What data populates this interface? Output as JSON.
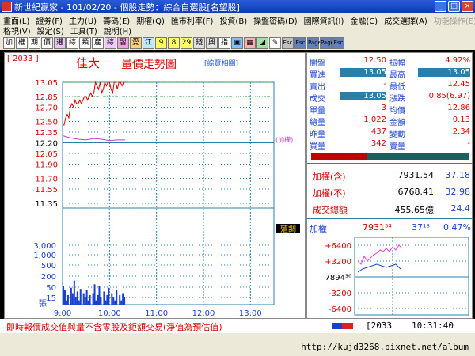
{
  "window": {
    "title": "新世紀贏家 - 101/02/20 - 個股走勢：綜合自選股[名望股]",
    "buttons": [
      "_",
      "□",
      "×"
    ]
  },
  "menu": {
    "row1": [
      {
        "label": "畫面(L)",
        "disabled": false
      },
      {
        "label": "證券(F)",
        "disabled": false
      },
      {
        "label": "主力(U)",
        "disabled": false
      },
      {
        "label": "籌碼(E)",
        "disabled": false
      },
      {
        "label": "期權(Q)",
        "disabled": false
      },
      {
        "label": "匯市利率(F)",
        "disabled": false
      },
      {
        "label": "投資(B)",
        "disabled": false
      },
      {
        "label": "操盤密碼(D)",
        "disabled": false
      },
      {
        "label": "國際資訊(I)",
        "disabled": false
      },
      {
        "label": "金融(C)",
        "disabled": false
      },
      {
        "label": "成交選擇(A)",
        "disabled": false
      },
      {
        "label": "功能操作(E)",
        "disabled": true
      }
    ],
    "row2": [
      {
        "label": "格視(V)",
        "disabled": false
      },
      {
        "label": "設定(S)",
        "disabled": false
      },
      {
        "label": "工具(T)",
        "disabled": false
      },
      {
        "label": "說明(H)",
        "disabled": false
      }
    ]
  },
  "toolbar": [
    {
      "label": "加",
      "bg": "#ffffff"
    },
    {
      "label": "權",
      "bg": "#ffffff"
    },
    {
      "label": "期",
      "bg": "#ffffff"
    },
    {
      "label": "價",
      "bg": "#ffffff"
    },
    {
      "label": "選",
      "bg": "#e6c8f0"
    },
    {
      "label": "綜",
      "bg": "#ffffff"
    },
    {
      "label": "類",
      "bg": "#ffffff"
    },
    {
      "label": "產",
      "bg": "#ffffff"
    },
    {
      "label": "綜",
      "bg": "#f0c8ff"
    },
    {
      "label": "習",
      "bg": "#f0a0e0"
    },
    {
      "label": "愛",
      "bg": "#ffd080"
    },
    {
      "label": "江",
      "bg": "#c0e8ff"
    },
    {
      "label": "9",
      "bg": "#ffff60"
    },
    {
      "label": "8",
      "bg": "#ffff60"
    },
    {
      "label": "29",
      "bg": "#ffff60"
    },
    {
      "label": "錢",
      "bg": "#e0e0e0"
    },
    {
      "label": "興",
      "bg": "#e0e0e0"
    },
    {
      "label": "指",
      "bg": "#ffffff"
    },
    {
      "label": "▣",
      "bg": "#80c0ff"
    },
    {
      "label": "▦",
      "bg": "#ffb0b0"
    },
    {
      "label": "◪",
      "bg": "#a0e0a0"
    },
    {
      "label": "✎",
      "bg": "#ffffff"
    },
    {
      "label": "Esc",
      "bg": "#c0c0c0"
    },
    {
      "label": "Esc",
      "bg": "#6080c0"
    },
    {
      "label": "Page",
      "bg": "#6080c0"
    },
    {
      "label": "Page",
      "bg": "#6080c0"
    },
    {
      "label": "Esc",
      "bg": "#6080c0"
    }
  ],
  "header": {
    "code": "[ 2033 ]",
    "name": "佳大",
    "chart_title": "量價走勢圖",
    "related_button": "[綜覽相關]"
  },
  "chart_data": {
    "type": "line",
    "price_ticks": [
      "13.05",
      "12.85",
      "12.70",
      "12.50",
      "12.35",
      "12.20",
      "12.05",
      "11.90",
      "11.70",
      "11.55",
      "11.35"
    ],
    "price_ref": 12.2,
    "price_limit_up": 13.05,
    "price_limit_down": 11.35,
    "x_labels": [
      "9:00",
      "10:00",
      "11:00",
      "12:00",
      "13:00"
    ],
    "time_domain_minutes": [
      0,
      270
    ],
    "volume_ticks": [
      "3,000",
      "1,000",
      "500",
      "200",
      "50",
      "15"
    ],
    "volume_unit": "張",
    "right_tag": "(加權)",
    "right_box": "殖調",
    "price_series": [
      [
        0,
        12.45
      ],
      [
        2,
        12.45
      ],
      [
        4,
        12.55
      ],
      [
        6,
        12.6
      ],
      [
        8,
        12.55
      ],
      [
        10,
        12.7
      ],
      [
        12,
        12.75
      ],
      [
        14,
        12.7
      ],
      [
        16,
        12.8
      ],
      [
        18,
        12.75
      ],
      [
        20,
        12.75
      ],
      [
        22,
        12.8
      ],
      [
        24,
        12.75
      ],
      [
        26,
        12.8
      ],
      [
        28,
        12.85
      ],
      [
        30,
        12.85
      ],
      [
        32,
        12.8
      ],
      [
        34,
        12.85
      ],
      [
        36,
        12.9
      ],
      [
        38,
        12.85
      ],
      [
        40,
        12.9
      ],
      [
        42,
        13.05
      ],
      [
        44,
        13.0
      ],
      [
        46,
        12.95
      ],
      [
        48,
        13.05
      ],
      [
        50,
        12.9
      ],
      [
        52,
        12.95
      ],
      [
        54,
        13.05
      ],
      [
        56,
        13.0
      ],
      [
        58,
        13.05
      ],
      [
        60,
        13.05
      ],
      [
        62,
        12.95
      ],
      [
        64,
        12.9
      ],
      [
        66,
        13.05
      ],
      [
        68,
        13.05
      ],
      [
        70,
        12.95
      ],
      [
        72,
        13.05
      ],
      [
        74,
        13.05
      ],
      [
        76,
        13.0
      ],
      [
        78,
        13.05
      ],
      [
        80,
        13.05
      ]
    ],
    "avg_series": [
      [
        0,
        12.3
      ],
      [
        10,
        12.27
      ],
      [
        20,
        12.25
      ],
      [
        30,
        12.24
      ],
      [
        40,
        12.26
      ],
      [
        50,
        12.25
      ],
      [
        60,
        12.23
      ],
      [
        70,
        12.24
      ],
      [
        80,
        12.24
      ]
    ],
    "volume_series": [
      [
        1,
        60
      ],
      [
        3,
        40
      ],
      [
        5,
        15
      ],
      [
        7,
        25
      ],
      [
        9,
        8
      ],
      [
        11,
        50
      ],
      [
        13,
        30
      ],
      [
        15,
        100
      ],
      [
        17,
        20
      ],
      [
        19,
        35
      ],
      [
        21,
        15
      ],
      [
        23,
        45
      ],
      [
        25,
        10
      ],
      [
        27,
        30
      ],
      [
        29,
        20
      ],
      [
        31,
        40
      ],
      [
        33,
        15
      ],
      [
        35,
        25
      ],
      [
        37,
        8
      ],
      [
        39,
        30
      ],
      [
        41,
        70
      ],
      [
        43,
        15
      ],
      [
        45,
        25
      ],
      [
        47,
        60
      ],
      [
        49,
        20
      ],
      [
        51,
        10
      ],
      [
        53,
        35
      ],
      [
        55,
        15
      ],
      [
        57,
        25
      ],
      [
        59,
        50
      ],
      [
        61,
        10
      ],
      [
        63,
        30
      ],
      [
        65,
        20
      ],
      [
        67,
        15
      ],
      [
        69,
        40
      ],
      [
        71,
        10
      ],
      [
        73,
        25
      ],
      [
        75,
        15
      ],
      [
        77,
        30
      ],
      [
        79,
        20
      ]
    ]
  },
  "quote": {
    "rows": [
      {
        "l1": "開盤",
        "v1": "12.50",
        "l2": "振幅",
        "v2": "4.92%",
        "c1": "#d00",
        "c2": "#d00",
        "h1": false,
        "h2": false
      },
      {
        "l1": "買進",
        "v1": "13.05",
        "l2": "最高",
        "v2": "13.05",
        "c1": "#fff",
        "c2": "#fff",
        "h1": true,
        "h2": true
      },
      {
        "l1": "賣出",
        "v1": "-",
        "l2": "最低",
        "v2": "12.45",
        "c1": "#d00",
        "c2": "#d00",
        "h1": false,
        "h2": false
      },
      {
        "l1": "成交",
        "v1": "13.05",
        "l2": "漲跌",
        "v2": "0.85(6.97)",
        "c1": "#fff",
        "c2": "#d00",
        "h1": true,
        "h2": false
      },
      {
        "l1": "單量",
        "v1": "3",
        "l2": "均價",
        "v2": "12.86",
        "c1": "#d00",
        "c2": "#d00",
        "h1": false,
        "h2": false
      },
      {
        "l1": "總量",
        "v1": "1,022",
        "l2": "金額",
        "v2": "0.13",
        "c1": "#d00",
        "c2": "#d00",
        "h1": false,
        "h2": false
      },
      {
        "l1": "昨量",
        "v1": "437",
        "l2": "變動",
        "v2": "2.34",
        "c1": "#d00",
        "c2": "#d00",
        "h1": false,
        "h2": false
      },
      {
        "l1": "買量",
        "v1": "342",
        "l2": "賣量",
        "v2": "-",
        "c1": "#d00",
        "c2": "#d00",
        "h1": false,
        "h2": false
      }
    ],
    "buy_sell_ratio": 0.35
  },
  "index": {
    "rows": [
      {
        "label": "加權(含)",
        "v1": "7931.54",
        "v2": "37.18"
      },
      {
        "label": "加權(不)",
        "v1": "6768.41",
        "v2": "32.98"
      },
      {
        "label": "成交總額",
        "v1": "455.65億",
        "v2": "24.4"
      }
    ],
    "mini": {
      "label": "加權",
      "value": "7931⁵⁴",
      "change": "37¹⁸",
      "pct": "0.47%",
      "ticks": [
        "+6400",
        "+3200",
        "7894³⁶",
        "-3200",
        "-6400"
      ]
    }
  },
  "status": {
    "message": "即時報價成交值與量不含零股及鉅額交易(淨值為預估值)",
    "code": "[2033",
    "time": "10:31:40"
  },
  "footer": {
    "url": "http://kujd3268.pixnet.net/album"
  }
}
